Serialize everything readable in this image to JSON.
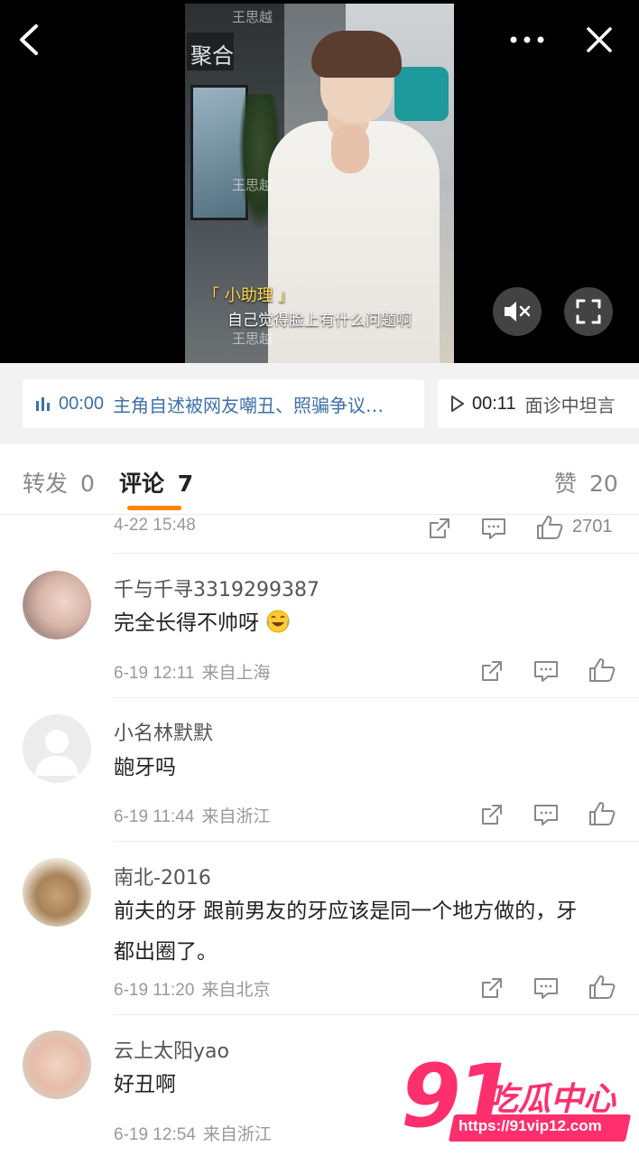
{
  "video": {
    "subtitle_tag": "「 小助理 」",
    "subtitle_text": "自己觉得脸上有什么问题啊",
    "watermark": "王思越"
  },
  "chapters": [
    {
      "time": "00:00",
      "title": "主角自述被网友嘲丑、照骗争议…",
      "state": "playing"
    },
    {
      "time": "00:11",
      "title": "面诊中坦言",
      "state": "idle"
    }
  ],
  "tabs": {
    "repost_label": "转发",
    "repost_count": "0",
    "comment_label": "评论",
    "comment_count": "7",
    "like_label": "赞",
    "like_count": "20"
  },
  "comments": [
    {
      "time": "4-22 15:48",
      "location": "",
      "likes": "2701"
    },
    {
      "nickname": "千与千寻3319299387",
      "text": "完全长得不帅呀",
      "time": "6-19 12:11",
      "location": "来自上海",
      "emoji": "laugh-cry"
    },
    {
      "nickname": "小名林默默",
      "text": "龅牙吗",
      "time": "6-19 11:44",
      "location": "来自浙江"
    },
    {
      "nickname": "南北-2016",
      "text": "前夫的牙 跟前男友的牙应该是同一个地方做的，牙都出圈了。",
      "time": "6-19 11:20",
      "location": "来自北京"
    },
    {
      "nickname": "云上太阳yao",
      "text": "好丑啊",
      "time": "6-19 12:54",
      "location": "来自浙江"
    }
  ],
  "logo": {
    "number": "91",
    "text": "吃瓜中心",
    "url": "https://91vip12.com"
  },
  "colors": {
    "accent": "#ff8200",
    "chapter_blue": "#3f70a8",
    "logo_pink": "#ff2f6e"
  }
}
